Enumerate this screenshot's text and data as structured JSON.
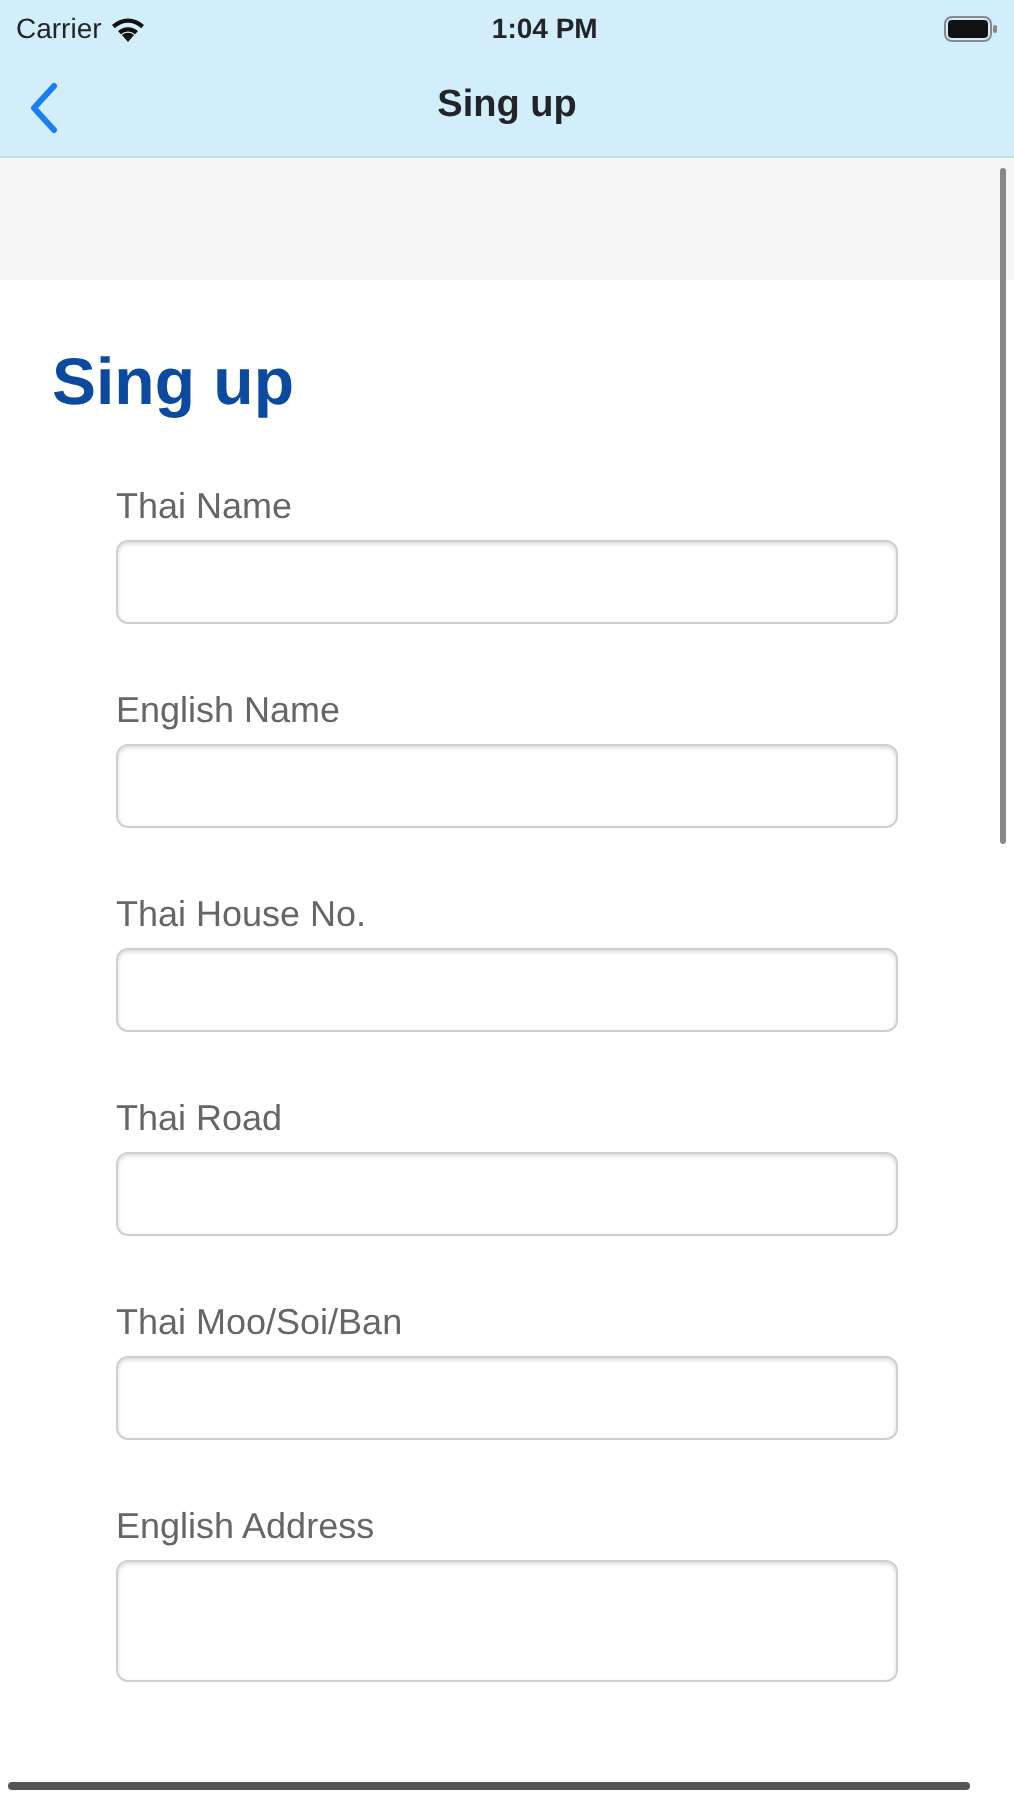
{
  "status_bar": {
    "carrier": "Carrier",
    "time": "1:04 PM"
  },
  "nav_bar": {
    "title": "Sing up"
  },
  "heading": "Sing up",
  "fields": [
    {
      "label": "Thai Name",
      "kind": "single"
    },
    {
      "label": "English Name",
      "kind": "single"
    },
    {
      "label": "Thai House No.",
      "kind": "single"
    },
    {
      "label": "Thai Road",
      "kind": "single"
    },
    {
      "label": "Thai Moo/Soi/Ban",
      "kind": "single"
    },
    {
      "label": "English Address",
      "kind": "multiline"
    }
  ]
}
